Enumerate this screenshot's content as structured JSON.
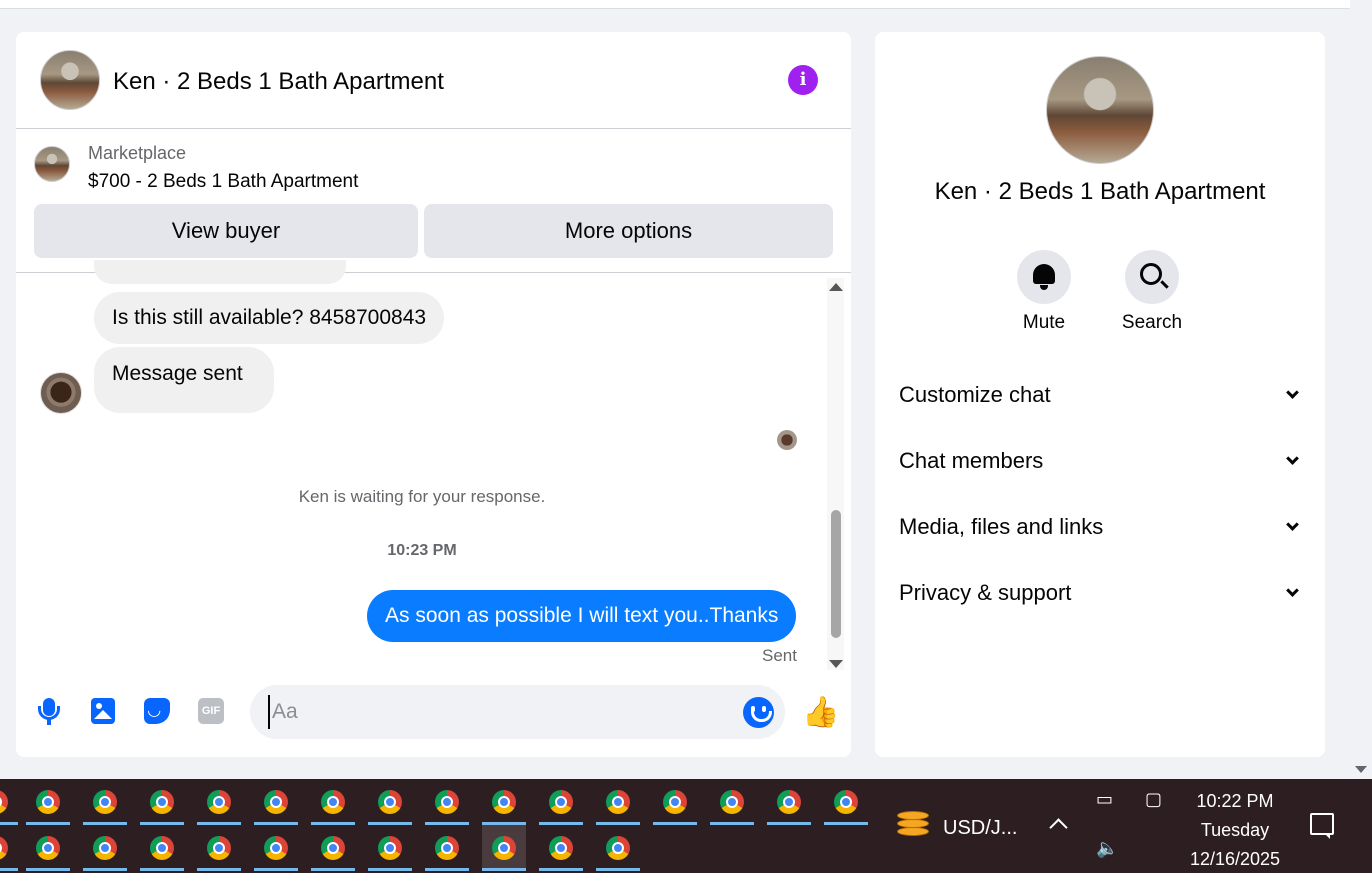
{
  "chat": {
    "title": "Ken · 2 Beds 1 Bath Apartment",
    "info_icon": "i",
    "marketplace_label": "Marketplace",
    "listing": "$700 - 2 Beds 1 Bath Apartment",
    "view_buyer": "View buyer",
    "more_options": "More options",
    "messages": [
      {
        "from": "ken",
        "text": "Is this still available? 8458700843"
      },
      {
        "from": "ken",
        "text": "Message sent"
      }
    ],
    "waiting_notice": "Ken is waiting for your response.",
    "timestamp": "10:23 PM",
    "outgoing": "As soon as possible I will text you..Thanks",
    "status": "Sent",
    "composer_placeholder": "Aa",
    "gif_label": "GIF",
    "like_icon": "👍"
  },
  "info_panel": {
    "title": "Ken · 2 Beds 1 Bath Apartment",
    "actions": [
      {
        "label": "Mute",
        "icon": "bell-icon"
      },
      {
        "label": "Search",
        "icon": "search-icon"
      }
    ],
    "sections": [
      "Customize chat",
      "Chat members",
      "Media, files and links",
      "Privacy & support"
    ]
  },
  "taskbar": {
    "tray_app": "USD/J...",
    "time": "10:22 PM",
    "day": "Tuesday",
    "date": "12/16/2025"
  }
}
